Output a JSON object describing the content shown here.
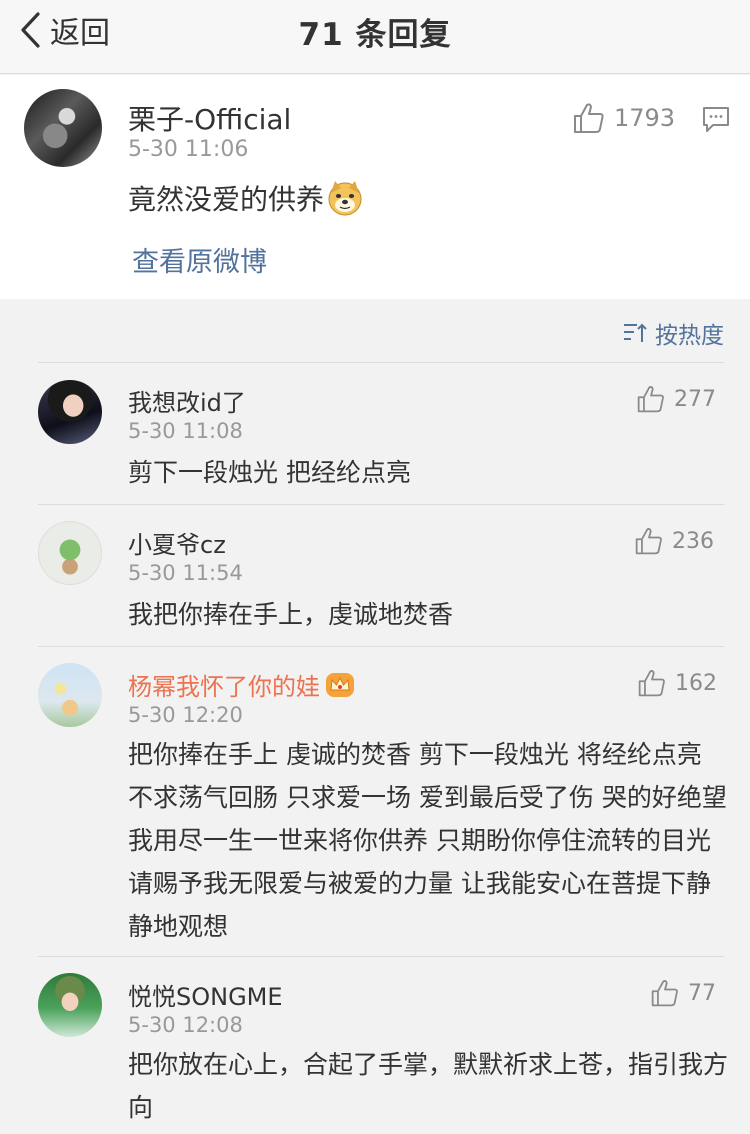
{
  "header": {
    "back_label": "返回",
    "title": "71 条回复"
  },
  "post": {
    "username": "栗子-Official",
    "time": "5-30 11:06",
    "text": "竟然没爱的供养",
    "likes": "1793",
    "view_original": "查看原微博"
  },
  "sort": {
    "label": "按热度"
  },
  "comments": [
    {
      "username": "我想改id了",
      "time": "5-30 11:08",
      "likes": "277",
      "text": "剪下一段烛光 把经纶点亮"
    },
    {
      "username": "小夏爷cz",
      "time": "5-30 11:54",
      "likes": "236",
      "text": "我把你捧在手上，虔诚地焚香"
    },
    {
      "username": "杨幂我怀了你的娃",
      "time": "5-30 12:20",
      "likes": "162",
      "text": "把你捧在手上 虔诚的焚香 剪下一段烛光 将经纶点亮 不求荡气回肠 只求爱一场 爱到最后受了伤 哭的好绝望 我用尽一生一世来将你供养 只期盼你停住流转的目光 请赐予我无限爱与被爱的力量 让我能安心在菩提下静静地观想"
    },
    {
      "username": "悦悦SONGME",
      "time": "5-30 12:08",
      "likes": "77",
      "text": "把你放在心上，合起了手掌，默默祈求上苍，指引我方向"
    }
  ],
  "colors": {
    "link": "#52739b",
    "vip_name": "#eb7350",
    "muted": "#999999"
  }
}
